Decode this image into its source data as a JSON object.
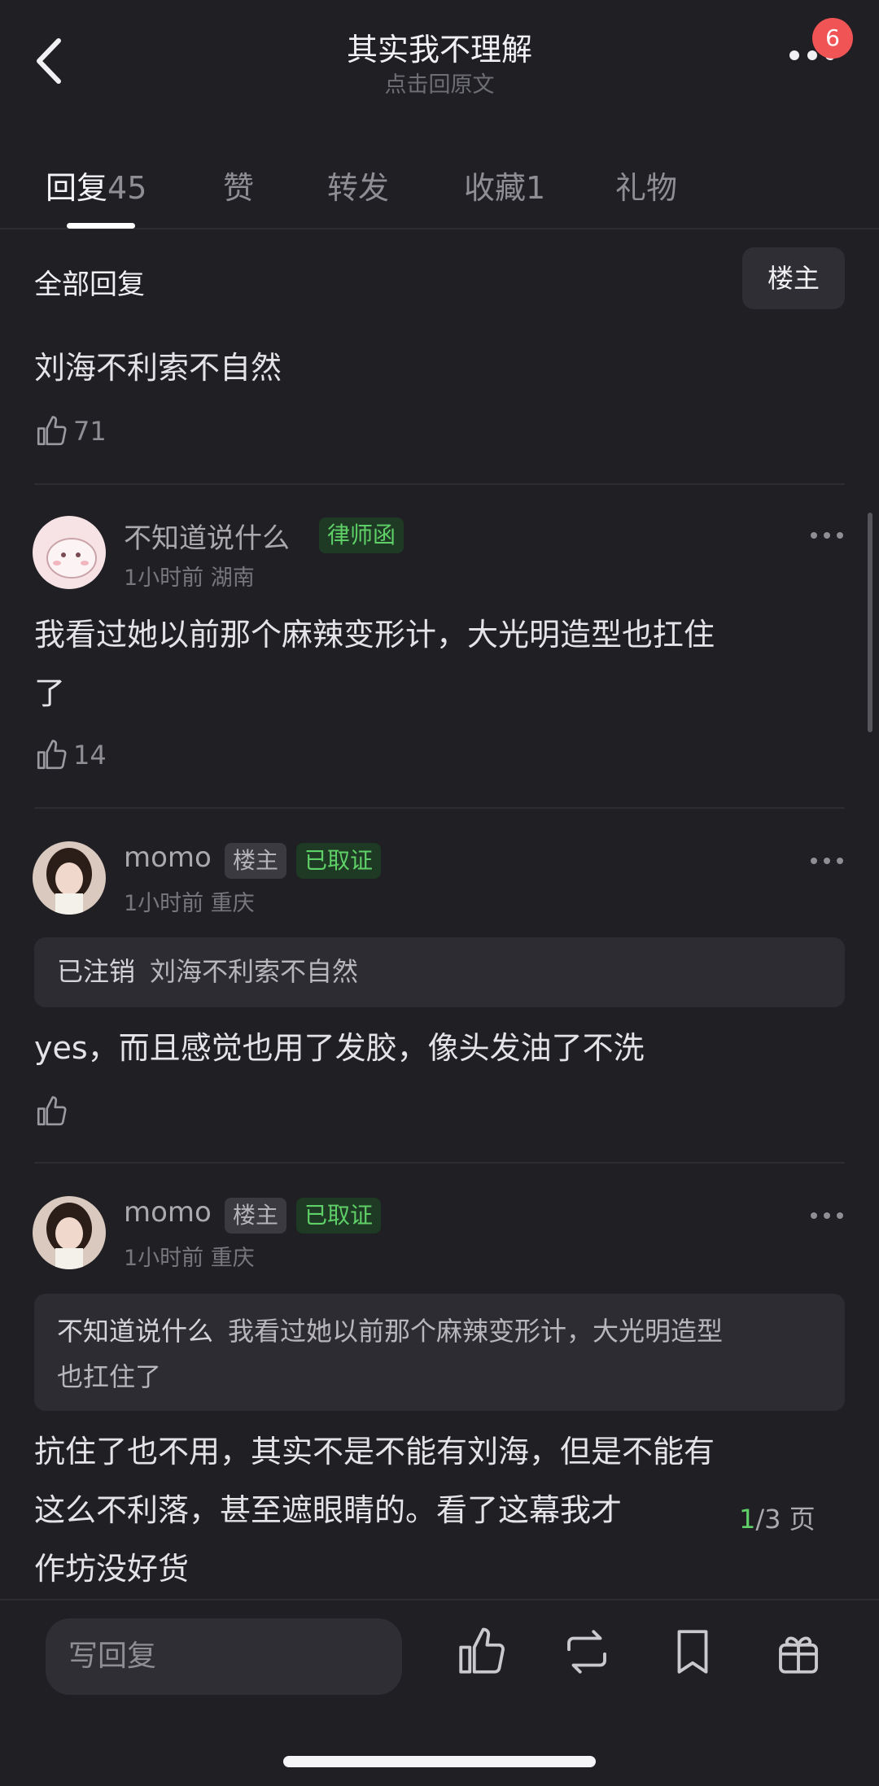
{
  "header": {
    "title": "其实我不理解",
    "subtitle": "点击回原文",
    "badge": "6"
  },
  "tabs": [
    {
      "label": "回复",
      "count": "45"
    },
    {
      "label": "赞",
      "count": ""
    },
    {
      "label": "转发",
      "count": ""
    },
    {
      "label": "收藏",
      "count": "1"
    },
    {
      "label": "礼物",
      "count": ""
    }
  ],
  "filter": {
    "section_title": "全部回复",
    "owner_button": "楼主"
  },
  "post": {
    "text": "刘海不利索不自然",
    "likes": "71"
  },
  "comments": [
    {
      "user": "不知道说什么",
      "tags": [
        "律师函"
      ],
      "time": "1小时前",
      "location": "湖南",
      "lines": [
        "我看过她以前那个麻辣变形计，大光明造型也扛住",
        "了"
      ],
      "likes": "14"
    },
    {
      "user": "momo",
      "tags": [
        "楼主",
        "已取证"
      ],
      "time": "1小时前",
      "location": "重庆",
      "quote_user": "已注销",
      "quote_text": "刘海不利索不自然",
      "lines": [
        "yes，而且感觉也用了发胶，像头发油了不洗"
      ],
      "likes": ""
    },
    {
      "user": "momo",
      "tags": [
        "楼主",
        "已取证"
      ],
      "time": "1小时前",
      "location": "重庆",
      "quote_user": "不知道说什么",
      "quote_lines": [
        "我看过她以前那个麻辣变形计，大光明造型",
        "也扛住了"
      ],
      "lines": [
        "抗住了也不用，其实不是不能有刘海，但是不能有",
        "这么不利落，甚至遮眼睛的。看了这幕我才",
        "作坊没好货"
      ],
      "likes": ""
    }
  ],
  "pager": {
    "current": "1",
    "total": "/3 页"
  },
  "bottom_bar": {
    "reply_placeholder": "写回复",
    "icons": [
      "thumbs-up-icon",
      "repost-icon",
      "bookmark-icon",
      "gift-icon"
    ]
  }
}
